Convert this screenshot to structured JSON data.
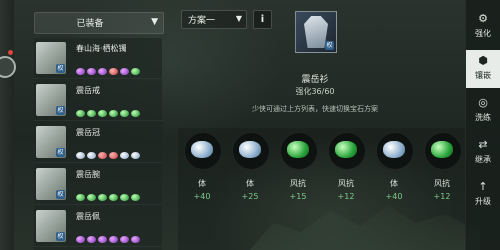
{
  "equipped_dropdown": {
    "label": "已装备",
    "icon": "chevron-down-icon"
  },
  "equipment_list": [
    {
      "name": "春山海·栖松镯",
      "badge": "权",
      "gems": [
        "purple",
        "purple",
        "purple",
        "red",
        "purple",
        "green"
      ]
    },
    {
      "name": "震岳戒",
      "badge": "权",
      "gems": [
        "green",
        "green",
        "green",
        "green",
        "green",
        "green"
      ]
    },
    {
      "name": "震岳冠",
      "badge": "权",
      "gems": [
        "blue",
        "blue",
        "red",
        "red",
        "blue",
        "blue"
      ]
    },
    {
      "name": "震岳腕",
      "badge": "权",
      "gems": [
        "green",
        "green",
        "green",
        "green",
        "green",
        "green"
      ]
    },
    {
      "name": "震岳佩",
      "badge": "权",
      "gems": [
        "purple",
        "purple",
        "purple",
        "purple",
        "purple",
        "purple"
      ]
    }
  ],
  "scheme": {
    "label": "方案一",
    "icon": "chevron-down-icon"
  },
  "info_button": {
    "label": "i"
  },
  "selected_item": {
    "name": "震岳衫",
    "level_label": "强化36/60",
    "badge": "权"
  },
  "hint": "少侠可通过上方列表，快速切换宝石方案",
  "gem_slots": [
    {
      "gem": "blue",
      "attr": "体",
      "value": "+40"
    },
    {
      "gem": "blue",
      "attr": "体",
      "value": "+25"
    },
    {
      "gem": "green",
      "attr": "风抗",
      "value": "+15"
    },
    {
      "gem": "green",
      "attr": "风抗",
      "value": "+12"
    },
    {
      "gem": "blue",
      "attr": "体",
      "value": "+40"
    },
    {
      "gem": "green",
      "attr": "风抗",
      "value": "+12"
    }
  ],
  "right_tabs": [
    {
      "label": "强化",
      "icon": "upgrade-icon",
      "active": false
    },
    {
      "label": "镶嵌",
      "icon": "hexagon-icon",
      "active": true
    },
    {
      "label": "洗练",
      "icon": "swirl-icon",
      "active": false
    },
    {
      "label": "继承",
      "icon": "inherit-icon",
      "active": false
    },
    {
      "label": "升级",
      "icon": "levelup-icon",
      "active": false
    }
  ]
}
